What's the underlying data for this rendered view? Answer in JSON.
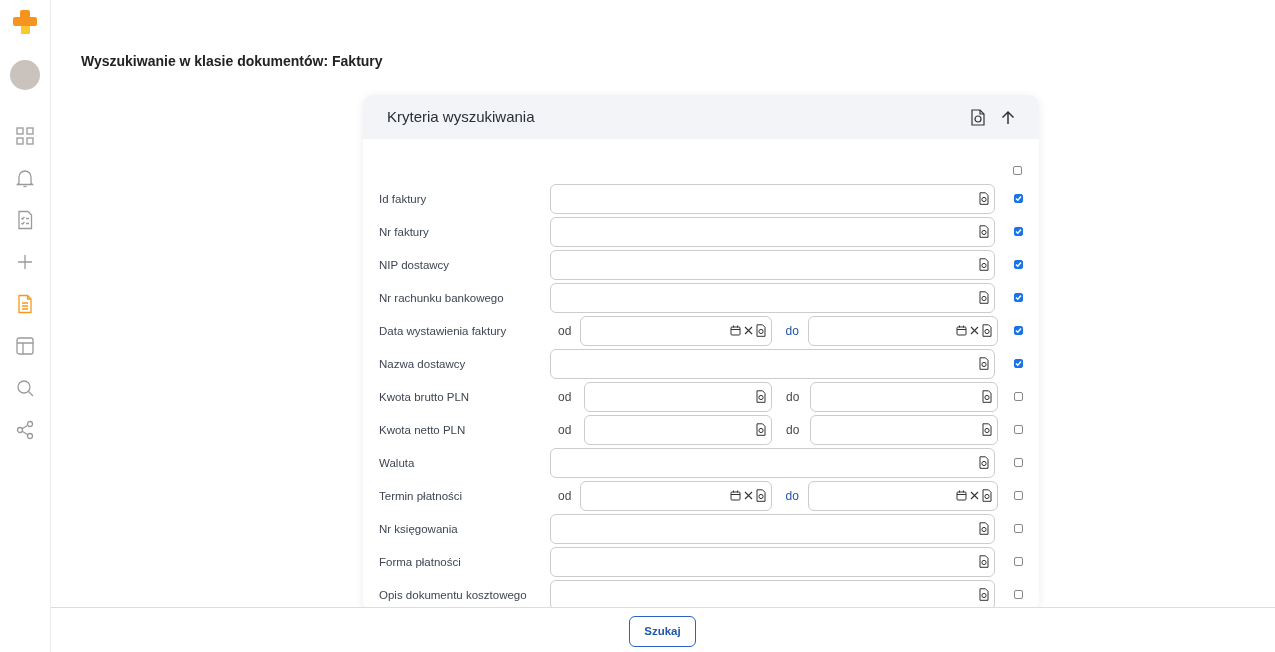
{
  "sidebar": {
    "items": [
      {
        "kind": "grid",
        "selected": false
      },
      {
        "kind": "bell",
        "selected": false
      },
      {
        "kind": "checklist",
        "selected": false
      },
      {
        "kind": "plus",
        "selected": false
      },
      {
        "kind": "document",
        "selected": true
      },
      {
        "kind": "layout",
        "selected": false
      },
      {
        "kind": "search",
        "selected": false
      },
      {
        "kind": "share",
        "selected": false
      }
    ]
  },
  "page_title": "Wyszukiwanie w klasie dokumentów: Faktury",
  "panel": {
    "title": "Kryteria wyszukiwania",
    "select_all_checked": false,
    "fields": [
      {
        "kind": "text",
        "label": "Id faktury",
        "checked": true
      },
      {
        "kind": "text",
        "label": "Nr faktury",
        "checked": true
      },
      {
        "kind": "text",
        "label": "NIP dostawcy",
        "checked": true
      },
      {
        "kind": "text",
        "label": "Nr rachunku bankowego",
        "checked": true
      },
      {
        "kind": "date_range",
        "label": "Data wystawienia faktury",
        "from_label": "od",
        "to_label": "do",
        "checked": true
      },
      {
        "kind": "text",
        "label": "Nazwa dostawcy",
        "checked": true
      },
      {
        "kind": "number_range",
        "label": "Kwota brutto PLN",
        "from_label": "od",
        "to_label": "do",
        "checked": false
      },
      {
        "kind": "number_range",
        "label": "Kwota netto PLN",
        "from_label": "od",
        "to_label": "do",
        "checked": false
      },
      {
        "kind": "text",
        "label": "Waluta",
        "checked": false
      },
      {
        "kind": "date_range",
        "label": "Termin płatności",
        "from_label": "od",
        "to_label": "do",
        "checked": false
      },
      {
        "kind": "text",
        "label": "Nr księgowania",
        "checked": false
      },
      {
        "kind": "text",
        "label": "Forma płatności",
        "checked": false
      },
      {
        "kind": "text",
        "label": "Opis dokumentu kosztowego",
        "checked": false
      }
    ]
  },
  "footer": {
    "search_button": "Szukaj"
  }
}
